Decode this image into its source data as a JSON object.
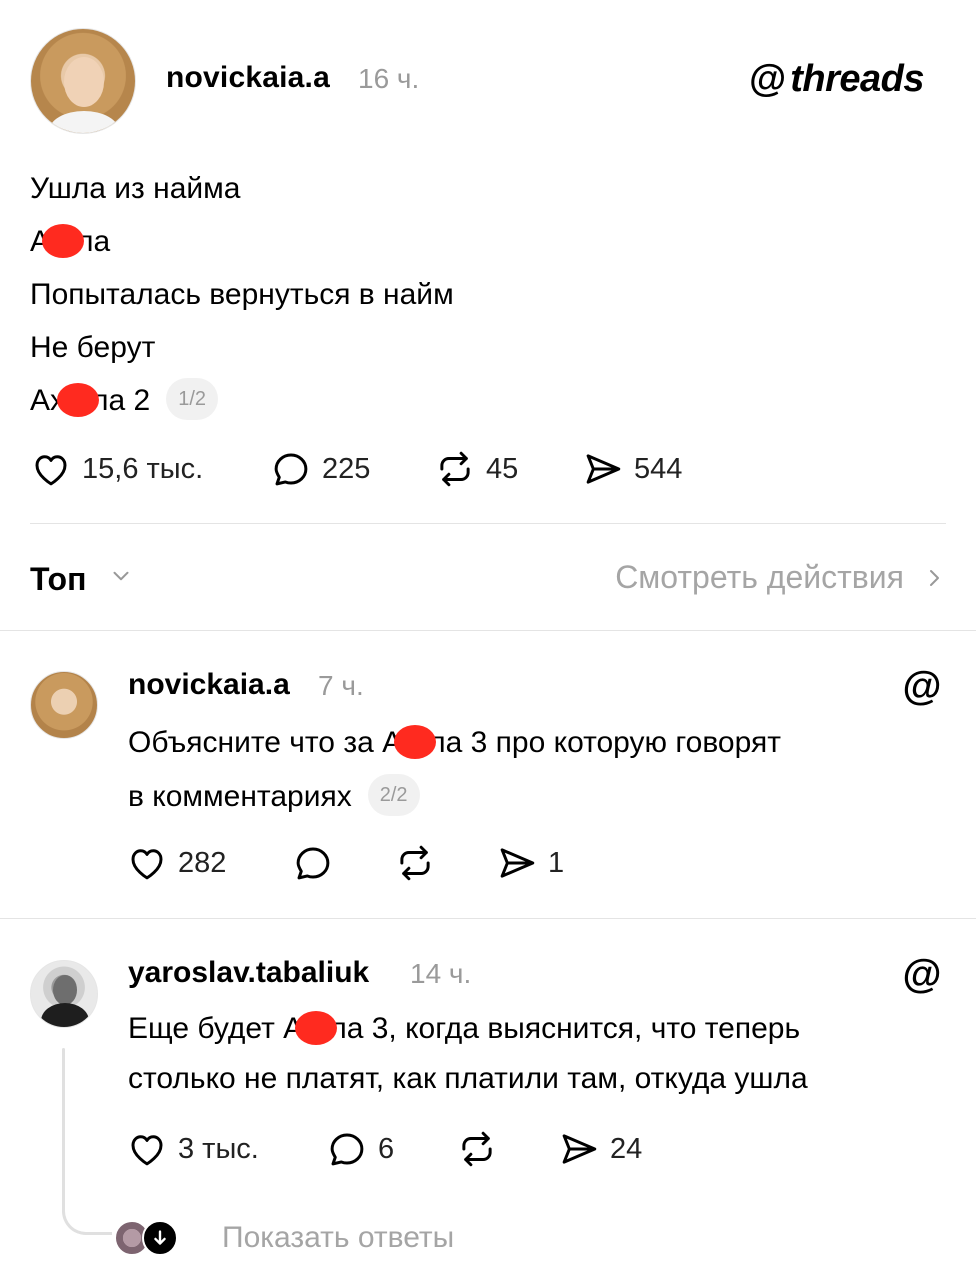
{
  "post": {
    "author": "novickaia.a",
    "time": "16 ч.",
    "brand": "threads",
    "brand_logo": "@",
    "lines": {
      "l1": "Ушла из найма",
      "l2a": "А",
      "l2b": "ла",
      "l3": "Попыталась вернуться в найм",
      "l4": "Не берут",
      "l5a": "Ах",
      "l5b": "ла 2",
      "pill": "1/2"
    },
    "stats": {
      "likes": "15,6 тыс.",
      "comments": "225",
      "reposts": "45",
      "shares": "544"
    }
  },
  "sort": {
    "label": "Топ",
    "activity": "Смотреть действия"
  },
  "replies": [
    {
      "author": "novickaia.a",
      "time": "7 ч.",
      "text_a": "Объясните что за А",
      "text_b": "ла 3 про которую говорят",
      "text_c": "в комментариях",
      "pill": "2/2",
      "likes": "282",
      "comments": "",
      "reposts": "",
      "shares": "1"
    },
    {
      "author": "yaroslav.tabaliuk",
      "time": "14 ч.",
      "text_a": "Еще будет А",
      "text_b": "ла 3, когда выяснится, что теперь",
      "text_c": "столько не платят, как платили там, откуда ушла",
      "likes": "3 тыс.",
      "comments": "6",
      "reposts": "",
      "shares": "24"
    }
  ],
  "show_replies": "Показать ответы",
  "icons": {
    "like": "heart-icon",
    "comment": "comment-bubble-icon",
    "repost": "repost-icon",
    "share": "send-icon",
    "threads": "threads-logo-icon"
  },
  "colors": {
    "redaction": "#ff2a1f",
    "muted": "#9a9a9a",
    "divider": "#e4e4e4"
  }
}
